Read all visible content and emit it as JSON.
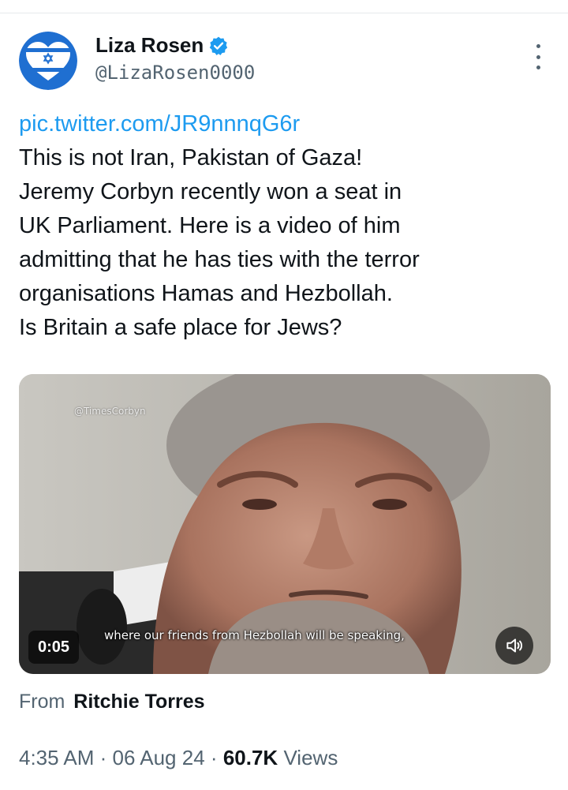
{
  "author": {
    "display_name": "Liza Rosen",
    "handle": "@LizaRosen0000",
    "avatar_icon": "israel-flag-heart-icon",
    "verified_icon": "verified-badge-icon"
  },
  "tweet": {
    "link": "pic.twitter.com/JR9nnnqG6r",
    "lines": [
      "This is not Iran, Pakistan of Gaza!",
      "Jeremy Corbyn recently won a seat in",
      "UK Parliament. Here is a video of him",
      "admitting that he has ties with the terror",
      "organisations Hamas and Hezbollah.",
      "Is Britain a safe place for Jews?"
    ]
  },
  "video": {
    "watermark": "@TimesCorbyn",
    "subtitle": "where our friends from Hezbollah will be speaking,",
    "duration": "0:05",
    "volume_icon": "speaker-volume-icon"
  },
  "attribution": {
    "prefix": "From",
    "name": "Ritchie Torres"
  },
  "meta": {
    "time": "4:35 AM",
    "separator": "·",
    "date": "06 Aug 24",
    "views_count": "60.7K",
    "views_label": "Views"
  },
  "colors": {
    "link": "#1d9bf0",
    "verified": "#1d9bf0",
    "secondary_text": "#536471",
    "primary_text": "#0f1419"
  }
}
